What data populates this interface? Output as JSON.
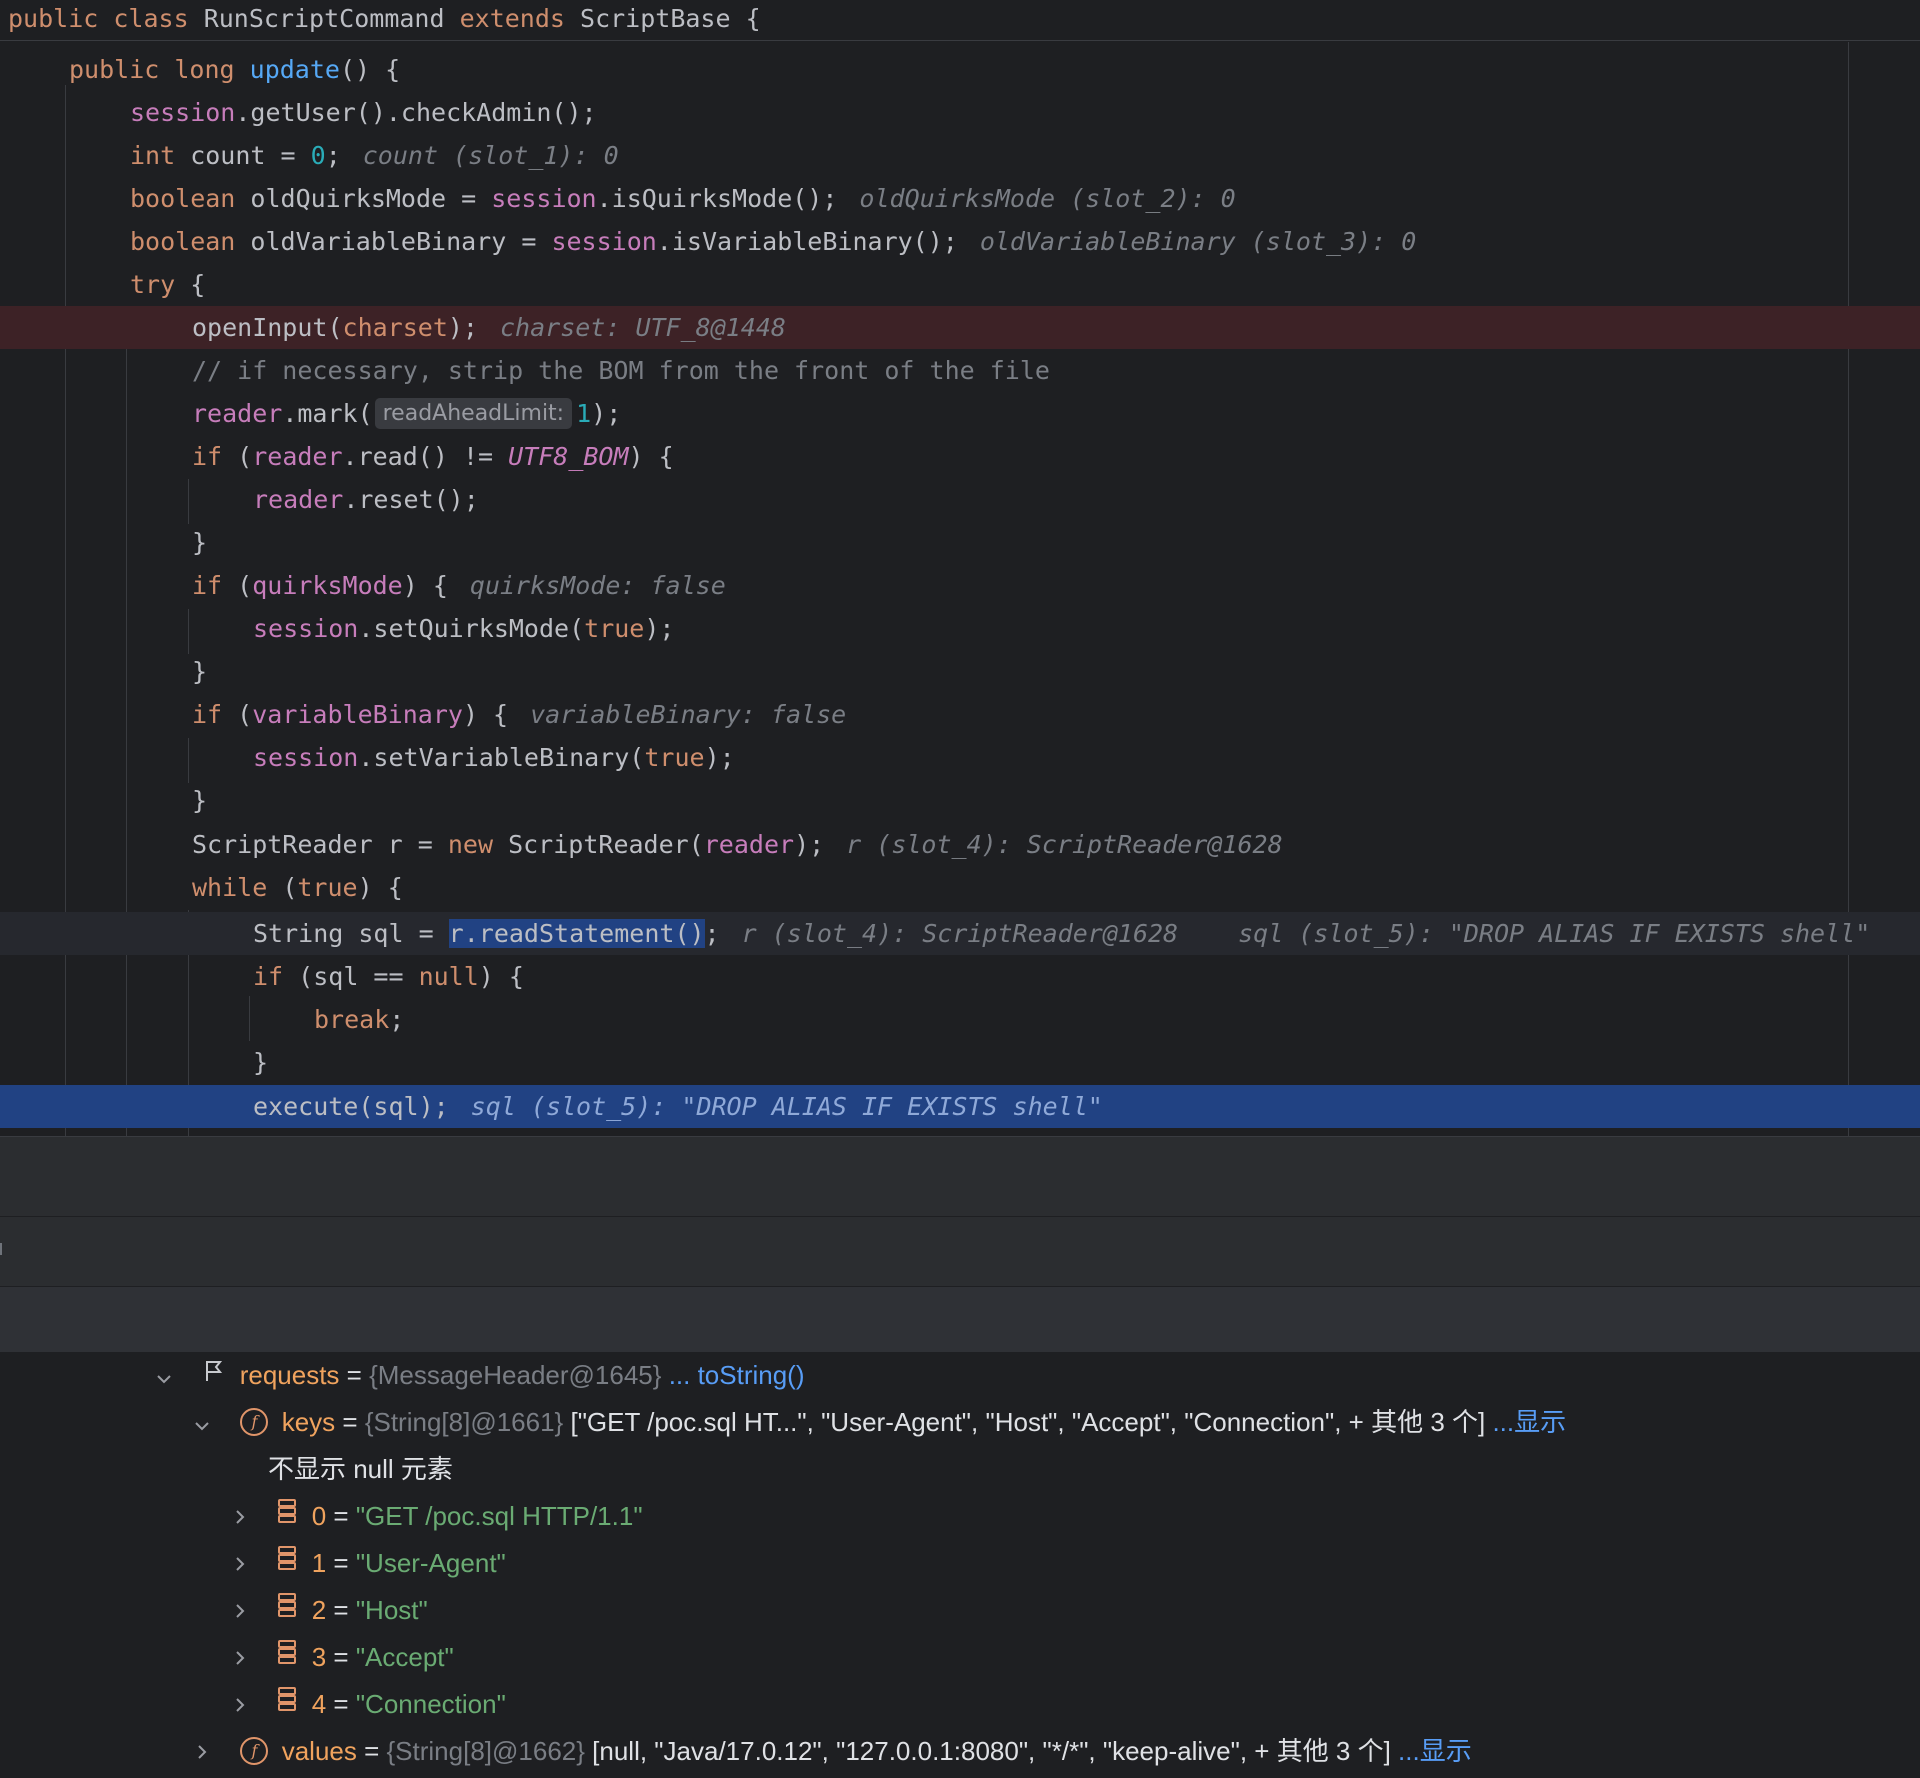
{
  "editor": {
    "class_decl": {
      "kw1": "public",
      "kw2": "class",
      "name": "RunScriptCommand",
      "kw3": "extends",
      "parent": "ScriptBase",
      "brace": "{"
    },
    "m_public": "public",
    "m_long": "long",
    "m_update": "update",
    "m_parens": "() {",
    "l1_session": "session",
    "l1_rest": ".getUser().checkAdmin();",
    "l2_int": "int",
    "l2_mid": " count = ",
    "l2_zero": "0",
    "l2_semi": ";",
    "l2_hint": "count (slot_1): 0",
    "l3_bool": "boolean",
    "l3_mid": " oldQuirksMode = ",
    "l3_session": "session",
    "l3_rest": ".isQuirksMode();",
    "l3_hint": "oldQuirksMode (slot_2): 0",
    "l4_bool": "boolean",
    "l4_mid": " oldVariableBinary = ",
    "l4_session": "session",
    "l4_rest": ".isVariableBinary();",
    "l4_hint": "oldVariableBinary (slot_3): 0",
    "l5_try": "try",
    "l5_brace": " {",
    "l6_call": "openInput(",
    "l6_charset": "charset",
    "l6_end": ");",
    "l6_hint": "charset: UTF_8@1448",
    "l7_comment": "// if necessary, strip the BOM from the front of the file",
    "l8_reader": "reader",
    "l8_mark": ".mark(",
    "l8_param": "readAheadLimit:",
    "l8_one": "1",
    "l8_end": ");",
    "l9_if": "if",
    "l9_open": " (",
    "l9_reader": "reader",
    "l9_mid": ".read() != ",
    "l9_const": "UTF8_BOM",
    "l9_end": ") {",
    "l10_reader": "reader",
    "l10_rest": ".reset();",
    "close": "}",
    "l12_if": "if",
    "l12_open": " (",
    "l12_var": "quirksMode",
    "l12_end": ") {",
    "l12_hint": "quirksMode: false",
    "l13_session": "session",
    "l13_mid": ".setQuirksMode(",
    "l13_true": "true",
    "l13_end": ");",
    "l15_if": "if",
    "l15_open": " (",
    "l15_var": "variableBinary",
    "l15_end": ") {",
    "l15_hint": "variableBinary: false",
    "l16_session": "session",
    "l16_mid": ".setVariableBinary(",
    "l16_true": "true",
    "l16_end": ");",
    "l18_start": "ScriptReader r = ",
    "l18_new": "new",
    "l18_mid": " ScriptReader(",
    "l18_reader": "reader",
    "l18_end": ");",
    "l18_hint": "r (slot_4): ScriptReader@1628",
    "l19_while": "while",
    "l19_open": " (",
    "l19_true": "true",
    "l19_end": ") {",
    "l20_start": "String sql = ",
    "l20_sel": "r.readStatement()",
    "l20_semi": ";",
    "l20_hint1": "r (slot_4): ScriptReader@1628",
    "l20_hint2": "sql (slot_5): \"DROP ALIAS IF EXISTS shell\"",
    "l21_if": "if",
    "l21_mid": " (sql == ",
    "l21_null": "null",
    "l21_end": ") {",
    "l22_break": "break",
    "l22_semi": ";",
    "l24_exec": "execute(sql);",
    "l24_hint": "sql (slot_5): \"DROP ALIAS IF EXISTS shell\""
  },
  "debugger": {
    "requests": {
      "name": "requests",
      "eq": " = ",
      "type": "{MessageHeader@1645}",
      "link": "... toString()"
    },
    "keys": {
      "name": "keys",
      "eq": " = ",
      "type": "{String[8]@1661}",
      "value": " [\"GET /poc.sql HT...\", \"User-Agent\", \"Host\", \"Accept\", \"Connection\", + 其他 3 个]",
      "link": " ...显示"
    },
    "null_note": "不显示 null 元素",
    "items": [
      {
        "idx": "0",
        "eq": " = ",
        "val": "\"GET /poc.sql HTTP/1.1\""
      },
      {
        "idx": "1",
        "eq": " = ",
        "val": "\"User-Agent\""
      },
      {
        "idx": "2",
        "eq": " = ",
        "val": "\"Host\""
      },
      {
        "idx": "3",
        "eq": " = ",
        "val": "\"Accept\""
      },
      {
        "idx": "4",
        "eq": " = ",
        "val": "\"Connection\""
      }
    ],
    "values": {
      "name": "values",
      "eq": " = ",
      "type": "{String[8]@1662}",
      "value": " [null, \"Java/17.0.12\", \"127.0.0.1:8080\", \"*/*\", \"keep-alive\", + 其他 3 个]",
      "link": " ...显示"
    },
    "icons": {
      "field": "f",
      "expanded": "chevron-down-icon",
      "collapsed": "chevron-right-icon"
    }
  }
}
